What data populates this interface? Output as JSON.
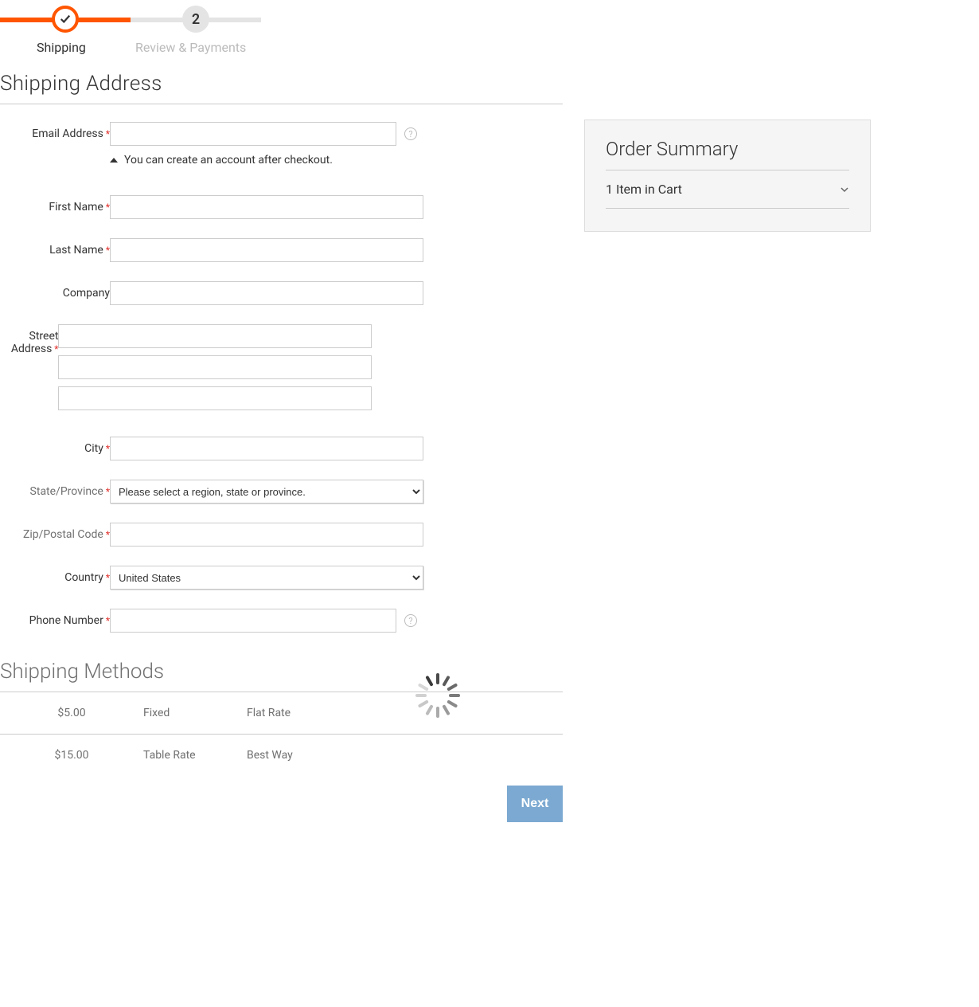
{
  "progress": {
    "step1_label": "Shipping",
    "step2_label": "Review & Payments",
    "step2_number": "2"
  },
  "titles": {
    "shipping_address": "Shipping Address",
    "shipping_methods": "Shipping Methods"
  },
  "fields": {
    "email_label": "Email Address",
    "firstname_label": "First Name",
    "lastname_label": "Last Name",
    "company_label": "Company",
    "street_label": "Street Address",
    "city_label": "City",
    "state_label": "State/Province",
    "zip_label": "Zip/Postal Code",
    "country_label": "Country",
    "phone_label": "Phone Number",
    "state_placeholder": "Please select a region, state or province.",
    "country_value": "United States"
  },
  "hints": {
    "post_checkout": "You can create an account after checkout."
  },
  "methods": [
    {
      "price": "$5.00",
      "type": "Fixed",
      "name": "Flat Rate"
    },
    {
      "price": "$15.00",
      "type": "Table Rate",
      "name": "Best Way"
    }
  ],
  "buttons": {
    "next": "Next"
  },
  "summary": {
    "title": "Order Summary",
    "cart_line": "1 Item in Cart"
  }
}
